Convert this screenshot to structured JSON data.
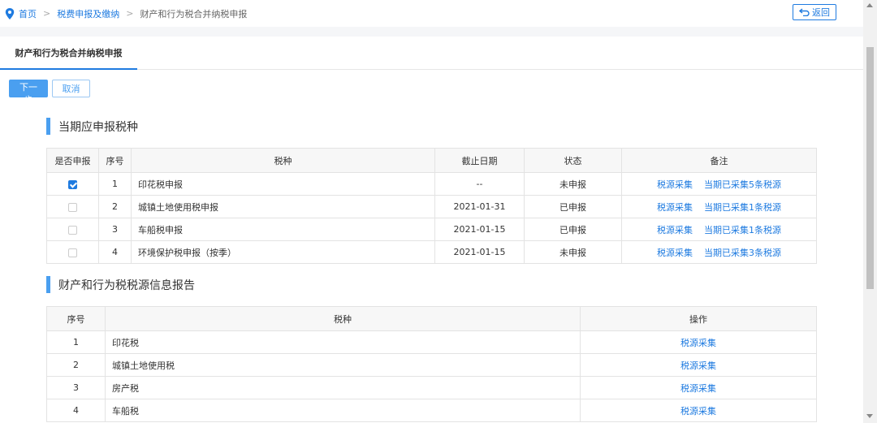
{
  "breadcrumb": {
    "home": "首页",
    "level1": "税费申报及缴纳",
    "current": "财产和行为税合并纳税申报",
    "separator": ">"
  },
  "back_button": {
    "label": "返回",
    "icon": "return-arrow-icon"
  },
  "tab": {
    "label": "财产和行为税合并纳税申报"
  },
  "actions": {
    "next_label": "下一步",
    "cancel_label": "取消"
  },
  "section1": {
    "title": "当期应申报税种",
    "headers": [
      "是否申报",
      "序号",
      "税种",
      "截止日期",
      "状态",
      "备注"
    ],
    "rows": [
      {
        "checked": true,
        "no": "1",
        "tax": "印花税申报",
        "deadline": "--",
        "status": "未申报",
        "collect": "税源采集",
        "collected": "当期已采集5条税源"
      },
      {
        "checked": false,
        "no": "2",
        "tax": "城镇土地使用税申报",
        "deadline": "2021-01-31",
        "status": "已申报",
        "collect": "税源采集",
        "collected": "当期已采集1条税源"
      },
      {
        "checked": false,
        "no": "3",
        "tax": "车船税申报",
        "deadline": "2021-01-15",
        "status": "已申报",
        "collect": "税源采集",
        "collected": "当期已采集1条税源"
      },
      {
        "checked": false,
        "no": "4",
        "tax": "环境保护税申报（按季）",
        "deadline": "2021-01-15",
        "status": "未申报",
        "collect": "税源采集",
        "collected": "当期已采集3条税源"
      }
    ]
  },
  "section2": {
    "title": "财产和行为税税源信息报告",
    "headers": [
      "序号",
      "税种",
      "操作"
    ],
    "rows": [
      {
        "no": "1",
        "tax": "印花税",
        "action": "税源采集"
      },
      {
        "no": "2",
        "tax": "城镇土地使用税",
        "action": "税源采集"
      },
      {
        "no": "3",
        "tax": "房产税",
        "action": "税源采集"
      },
      {
        "no": "4",
        "tax": "车船税",
        "action": "税源采集"
      }
    ]
  },
  "colors": {
    "accent": "#1f7be0",
    "primary_button": "#4a9ff0"
  }
}
